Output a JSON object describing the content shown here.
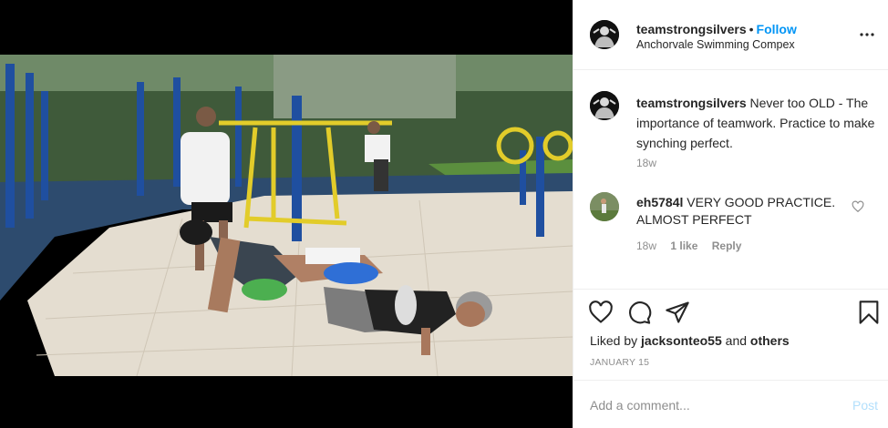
{
  "post": {
    "username": "teamstrongsilvers",
    "separator": "•",
    "follow_label": "Follow",
    "location": "Anchorvale Swimming Compex"
  },
  "caption": {
    "username": "teamstrongsilvers",
    "text": "Never too OLD - The importance of teamwork. Practice to make synching perfect.",
    "time": "18w"
  },
  "comment": {
    "username": "eh5784l",
    "text": "VERY GOOD PRACTICE. ALMOST PERFECT",
    "time": "18w",
    "likes": "1 like",
    "reply": "Reply"
  },
  "actions": {
    "liked_by_prefix": "Liked by",
    "liked_by_user": "jacksonteo55",
    "liked_by_and": "and",
    "liked_by_others": "others",
    "date": "JANUARY 15"
  },
  "add_comment": {
    "placeholder": "Add a comment...",
    "post_label": "Post"
  },
  "icons": {
    "more": "more-options-icon",
    "like": "heart-icon",
    "comment": "comment-icon",
    "share": "share-icon",
    "save": "bookmark-icon",
    "comment_like": "heart-icon"
  },
  "colors": {
    "follow": "#0095f6",
    "post_disabled": "#b2dffc",
    "muted": "#8e8e8e"
  }
}
